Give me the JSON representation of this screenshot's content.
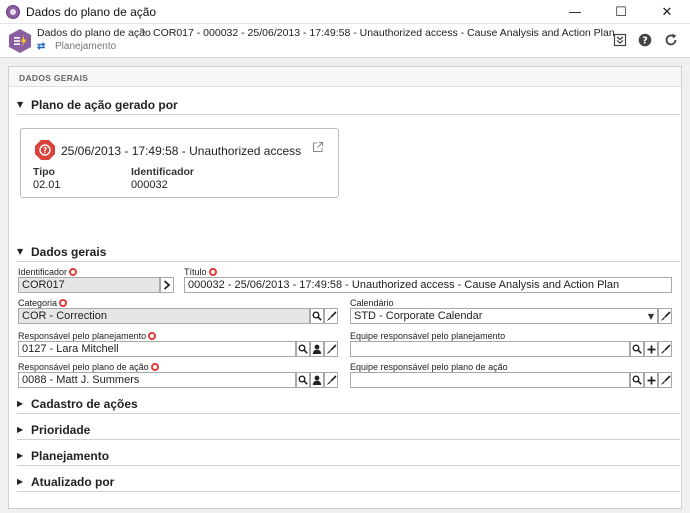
{
  "window": {
    "title": "Dados do plano de ação",
    "minimize_glyph": "—",
    "maximize_glyph": "☐",
    "close_glyph": "✕"
  },
  "header": {
    "breadcrumb_root": "Dados do plano de ação",
    "breadcrumb_separator": "›",
    "breadcrumb_title": "COR017 - 000032 - 25/06/2013 - 17:49:58 - Unauthorized access - Cause Analysis and Action Plan",
    "subtitle_icon": "⇄",
    "subtitle": "Planejamento"
  },
  "panel": {
    "header": "DADOS GERAIS"
  },
  "sections": {
    "origin": "Plano de ação gerado por",
    "general": "Dados gerais",
    "actions": "Cadastro de ações",
    "priority": "Prioridade",
    "planning": "Planejamento",
    "updated": "Atualizado por"
  },
  "origin_card": {
    "title": "25/06/2013 - 17:49:58 - Unauthorized access",
    "type_label": "Tipo",
    "type_value": "02.01",
    "id_label": "Identificador",
    "id_value": "000032"
  },
  "fields": {
    "identificador": {
      "label": "Identificador",
      "value": "COR017"
    },
    "titulo": {
      "label": "Título",
      "value": "000032 - 25/06/2013 - 17:49:58 - Unauthorized access - Cause Analysis and Action Plan"
    },
    "categoria": {
      "label": "Categoria",
      "value": "COR - Correction"
    },
    "calendario": {
      "label": "Calendário",
      "value": "STD - Corporate Calendar"
    },
    "resp_planejamento": {
      "label": "Responsável pelo planejamento",
      "value": "0127 - Lara Mitchell"
    },
    "equipe_planejamento": {
      "label": "Equipe responsável pelo planejamento",
      "value": ""
    },
    "resp_plano": {
      "label": "Responsável pelo plano de ação",
      "value": "0088 - Matt J. Summers"
    },
    "equipe_plano": {
      "label": "Equipe responsável pelo plano de ação",
      "value": ""
    }
  },
  "colors": {
    "accent": "#8a5ea0",
    "required": "#e23b3b",
    "alert": "#d9423b"
  }
}
